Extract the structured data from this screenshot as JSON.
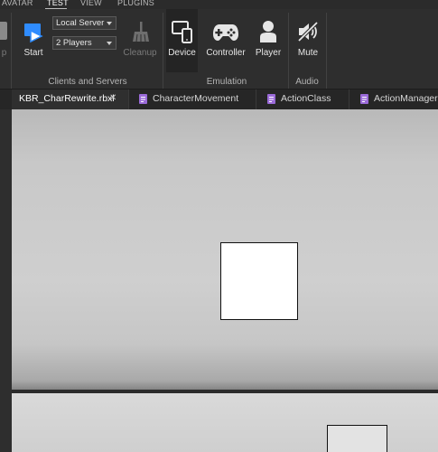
{
  "menu": {
    "tabs": [
      "AVATAR",
      "TEST",
      "VIEW",
      "PLUGINS"
    ],
    "active": "TEST"
  },
  "ribbon": {
    "left_partial_label": "p",
    "start_label": "Start",
    "server_dropdown": "Local Server",
    "players_dropdown": "2 Players",
    "cleanup_label": "Cleanup",
    "clients_group_label": "Clients and Servers",
    "device_label": "Device",
    "controller_label": "Controller",
    "player_label": "Player",
    "emulation_group_label": "Emulation",
    "mute_label": "Mute",
    "audio_group_label": "Audio"
  },
  "editor_tabs": [
    {
      "label": "KBR_CharRewrite.rbxl",
      "close": "✕",
      "active": true
    },
    {
      "label": "CharacterMovement",
      "close": "",
      "active": false
    },
    {
      "label": "ActionClass",
      "close": "",
      "active": false
    },
    {
      "label": "ActionManager",
      "close": "",
      "active": false
    }
  ],
  "colors": {
    "script_icon": "#9b6bd9",
    "start_icon": "#2f8cff"
  }
}
